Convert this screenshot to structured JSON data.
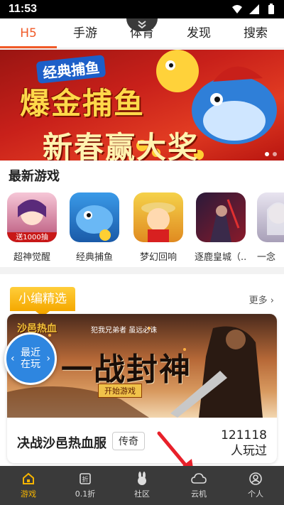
{
  "status_bar": {
    "time": "11:53"
  },
  "tabs": [
    "H5",
    "手游",
    "体育",
    "发现",
    "搜索"
  ],
  "banner": {
    "tag": "经典捕鱼",
    "line1": "爆金捕鱼",
    "line2": "新春赢大奖"
  },
  "new_games": {
    "title": "最新游戏",
    "items": [
      {
        "name": "超神觉醒",
        "badge": "送1000抽"
      },
      {
        "name": "经典捕鱼"
      },
      {
        "name": "梦幻回响"
      },
      {
        "name": "逐鹿皇城（..."
      },
      {
        "name": "一念"
      }
    ]
  },
  "editor_pick": {
    "title": "小编精选",
    "more": "更多",
    "logo": "沙邑热血",
    "slogan": "犯我兄弟者 虽远必诛",
    "headline": "一战封神",
    "start": "开始游戏",
    "game_name": "决战沙邑热血服",
    "genre": "传奇",
    "players_count": "121118",
    "players_suffix": "人玩过"
  },
  "recent_button": {
    "line1": "最近",
    "line2": "在玩"
  },
  "bottom_nav": [
    {
      "label": "游戏",
      "icon": "home-icon",
      "active": true
    },
    {
      "label": "0.1折",
      "icon": "discount-icon"
    },
    {
      "label": "社区",
      "icon": "rabbit-icon"
    },
    {
      "label": "云机",
      "icon": "cloud-icon"
    },
    {
      "label": "个人",
      "icon": "person-icon"
    }
  ],
  "colors": {
    "accent": "#f05a28",
    "nav_active": "#f5b400",
    "nav_bg": "#3a3a3a",
    "recent_blue": "#2e86e0"
  }
}
